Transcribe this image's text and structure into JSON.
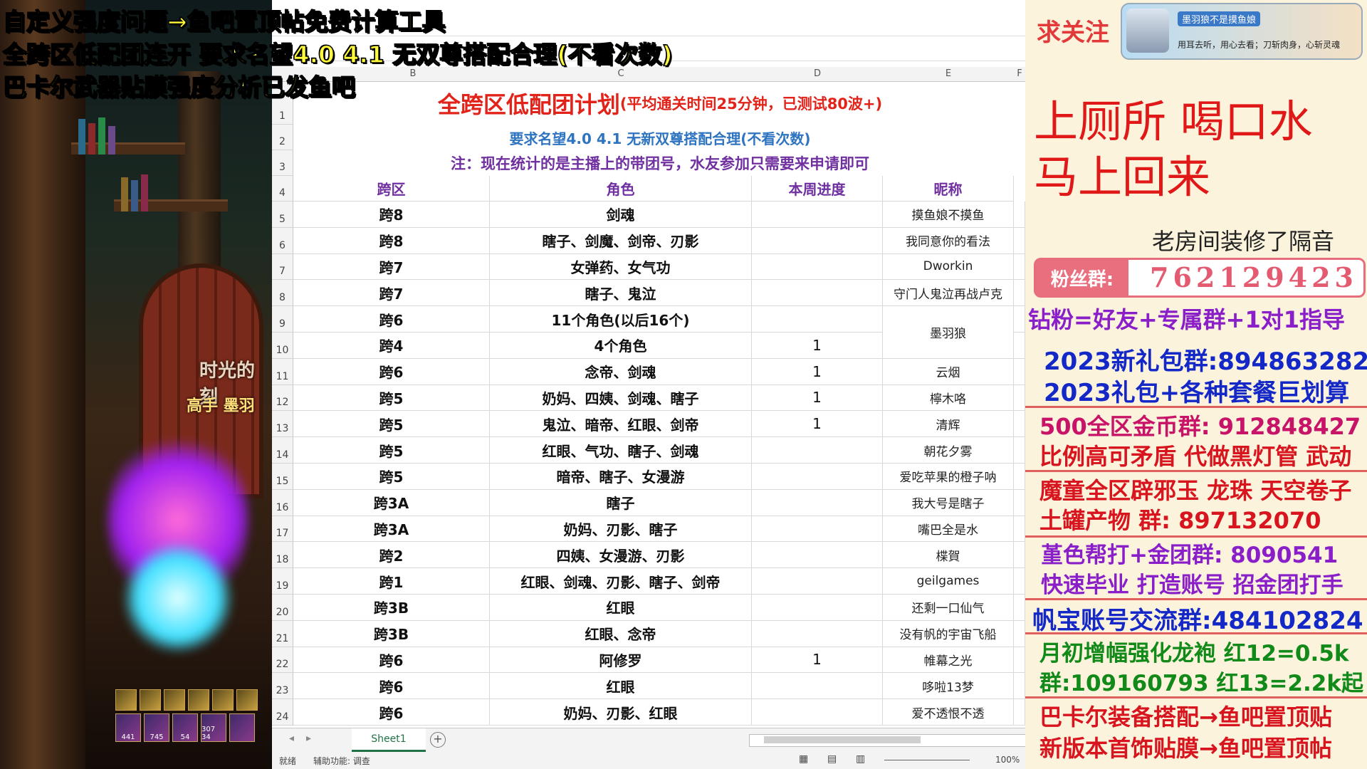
{
  "headline": [
    "自定义强度问题→鱼吧置顶帖免费计算工具",
    "全跨区低配团连开 要求名望4.0 4.1 无双尊搭配合理(不看次数)",
    "巴卡尔武器贴膜强度分析已发鱼吧"
  ],
  "game": {
    "sign_text": "时光的刻",
    "player_name": "高手 墨羽",
    "skill_counts": [
      "441",
      "745",
      "54",
      "307 34"
    ]
  },
  "sheet": {
    "columns": [
      "B",
      "C",
      "D",
      "E",
      "F"
    ],
    "title_main": "全跨区低配团计划",
    "title_note": "(平均通关时间25分钟，已测试80波+)",
    "subtitle": "要求名望4.0  4.1    无新双尊搭配合理(不看次数)",
    "note": "注：现在统计的是主播上的带团号，水友参加只需要来申请即可",
    "headers": [
      "跨区",
      "角色",
      "本周进度",
      "昵称"
    ],
    "rows": [
      {
        "n": "5",
        "zone": "跨8",
        "role": "剑魂",
        "prog": "",
        "nick": "摸鱼娘不摸鱼"
      },
      {
        "n": "6",
        "zone": "跨8",
        "role": "瞎子、剑魔、剑帝、刃影",
        "prog": "",
        "nick": "我同意你的看法"
      },
      {
        "n": "7",
        "zone": "跨7",
        "role": "女弹药、女气功",
        "prog": "",
        "nick": "Dworkin"
      },
      {
        "n": "8",
        "zone": "跨7",
        "role": "瞎子、鬼泣",
        "prog": "",
        "nick": "守门人鬼泣再战卢克"
      },
      {
        "n": "9",
        "zone": "跨6",
        "role": "11个角色(以后16个)",
        "prog": "",
        "nick": ""
      },
      {
        "n": "10",
        "zone": "跨4",
        "role": "4个角色",
        "prog": "1",
        "nick": ""
      },
      {
        "n": "11",
        "zone": "跨6",
        "role": "念帝、剑魂",
        "prog": "1",
        "nick": "云烟"
      },
      {
        "n": "12",
        "zone": "跨5",
        "role": "奶妈、四姨、剑魂、瞎子",
        "prog": "1",
        "nick": "檸木咯"
      },
      {
        "n": "13",
        "zone": "跨5",
        "role": "鬼泣、暗帝、红眼、剑帝",
        "prog": "1",
        "nick": "清辉"
      },
      {
        "n": "14",
        "zone": "跨5",
        "role": "红眼、气功、瞎子、剑魂",
        "prog": "",
        "nick": "朝花夕雾"
      },
      {
        "n": "15",
        "zone": "跨5",
        "role": "暗帝、瞎子、女漫游",
        "prog": "",
        "nick": "爱吃苹果的橙子呐"
      },
      {
        "n": "16",
        "zone": "跨3A",
        "role": "瞎子",
        "prog": "",
        "nick": "我大号是瞎子"
      },
      {
        "n": "17",
        "zone": "跨3A",
        "role": "奶妈、刃影、瞎子",
        "prog": "",
        "nick": "嘴巴全是水"
      },
      {
        "n": "18",
        "zone": "跨2",
        "role": "四姨、女漫游、刃影",
        "prog": "",
        "nick": "楪賀"
      },
      {
        "n": "19",
        "zone": "跨1",
        "role": "红眼、剑魂、刃影、瞎子、剑帝",
        "prog": "",
        "nick": "geilgames"
      },
      {
        "n": "20",
        "zone": "跨3B",
        "role": "红眼",
        "prog": "",
        "nick": "还剩一口仙气"
      },
      {
        "n": "21",
        "zone": "跨3B",
        "role": "红眼、念帝",
        "prog": "",
        "nick": "没有帆的宇宙飞船"
      },
      {
        "n": "22",
        "zone": "跨6",
        "role": "阿修罗",
        "prog": "1",
        "nick": "帷幕之光"
      },
      {
        "n": "23",
        "zone": "跨6",
        "role": "红眼",
        "prog": "",
        "nick": "哆啦13梦"
      },
      {
        "n": "24",
        "zone": "跨6",
        "role": "奶妈、刃影、红眼",
        "prog": "",
        "nick": "爱不透恨不透"
      }
    ],
    "merged_nick": "墨羽狼",
    "row_labels_top": [
      "1",
      "2",
      "3",
      "4"
    ],
    "tab": "Sheet1",
    "status_ready": "就绪",
    "status_access": "辅助功能: 调查",
    "zoom": "100%"
  },
  "right": {
    "follow": "求关注",
    "banner_name": "墨羽狼不是摸鱼娘",
    "banner_motto": "用耳去听，用心去看；刀斩肉身，心斩灵魂",
    "brb_line1": "上厕所  喝口水",
    "brb_line2": "马上回来",
    "room_note": "老房间装修了隔音",
    "fan_label": "粉丝群:",
    "fan_number": "762129423",
    "ads": [
      "钻粉=好友+专属群+1对1指导",
      "2023新礼包群:894863282",
      "2023礼包+各种套餐巨划算",
      "500全区金币群: 912848427",
      "比例高可矛盾 代做黑灯管 武动",
      "魔童全区辟邪玉 龙珠 天空卷子",
      "土罐产物 群: 897132070",
      "堇色帮打+金团群: 8090541",
      "快速毕业 打造账号 招金团打手",
      "帆宝账号交流群:484102824",
      "月初增幅强化龙袍 红12=0.5k",
      "群:109160793   红13=2.2k起",
      "巴卡尔装备搭配→鱼吧置顶贴",
      "新版本首饰贴膜→鱼吧置顶帖"
    ]
  }
}
